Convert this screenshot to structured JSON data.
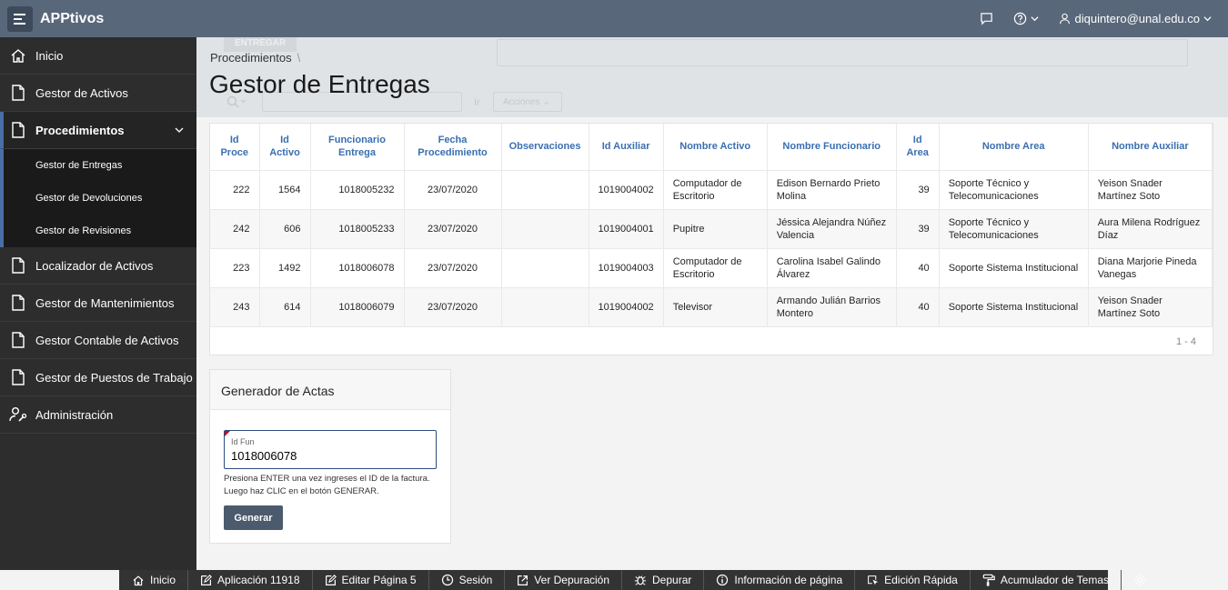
{
  "app": {
    "title": "APPtivos"
  },
  "header": {
    "user": "diquintero@unal.edu.co"
  },
  "sidebar": {
    "items": [
      {
        "label": "Inicio"
      },
      {
        "label": "Gestor de Activos"
      },
      {
        "label": "Procedimientos"
      },
      {
        "label": "Localizador de Activos"
      },
      {
        "label": "Gestor de Mantenimientos"
      },
      {
        "label": "Gestor Contable de Activos"
      },
      {
        "label": "Gestor de Puestos de Trabajo"
      },
      {
        "label": "Administración"
      }
    ],
    "sub": [
      {
        "label": "Gestor de Entregas"
      },
      {
        "label": "Gestor de Devoluciones"
      },
      {
        "label": "Gestor de Revisiones"
      }
    ]
  },
  "page": {
    "breadcrumb": "Procedimientos",
    "title": "Gestor de Entregas",
    "ghost_button": "ENTREGAR",
    "ghost_go": "Ir",
    "ghost_actions": "Acciones"
  },
  "table": {
    "headers": [
      "Id\nProce",
      "Id\nActivo",
      "Funcionario\nEntrega",
      "Fecha\nProcedimiento",
      "Observaciones",
      "Id Auxiliar",
      "Nombre Activo",
      "Nombre Funcionario",
      "Id\nArea",
      "Nombre Area",
      "Nombre Auxiliar"
    ],
    "rows": [
      [
        "222",
        "1564",
        "1018005232",
        "23/07/2020",
        "",
        "1019004002",
        "Computador de Escritorio",
        "Edison Bernardo Prieto Molina",
        "39",
        "Soporte Técnico y Telecomunicaciones",
        "Yeison Snader Martínez Soto"
      ],
      [
        "242",
        "606",
        "1018005233",
        "23/07/2020",
        "",
        "1019004001",
        "Pupitre",
        "Jéssica Alejandra Núñez Valencia",
        "39",
        "Soporte Técnico y Telecomunicaciones",
        "Aura Milena Rodríguez Díaz"
      ],
      [
        "223",
        "1492",
        "1018006078",
        "23/07/2020",
        "",
        "1019004003",
        "Computador de Escritorio",
        "Carolina Isabel Galindo Álvarez",
        "40",
        "Soporte Sistema Institucional",
        "Diana Marjorie Pineda Vanegas"
      ],
      [
        "243",
        "614",
        "1018006079",
        "23/07/2020",
        "",
        "1019004002",
        "Televisor",
        "Armando Julián Barrios Montero",
        "40",
        "Soporte Sistema Institucional",
        "Yeison Snader Martínez Soto"
      ]
    ],
    "pagination": "1 - 4"
  },
  "generator": {
    "title": "Generador de Actas",
    "field_label": "Id Fun",
    "field_value": "1018006078",
    "help": "Presiona ENTER una vez ingreses el ID de la factura. Luego haz CLIC en el botón GENERAR.",
    "button": "Generar"
  },
  "devbar": {
    "items": [
      {
        "label": "Inicio",
        "icon": "home-icon"
      },
      {
        "label": "Aplicación 11918",
        "icon": "edit-icon"
      },
      {
        "label": "Editar Página 5",
        "icon": "edit-icon"
      },
      {
        "label": "Sesión",
        "icon": "clock-icon"
      },
      {
        "label": "Ver Depuración",
        "icon": "external-link-icon"
      },
      {
        "label": "Depurar",
        "icon": "bug-icon"
      },
      {
        "label": "Información de página",
        "icon": "info-icon"
      },
      {
        "label": "Edición Rápida",
        "icon": "cursor-icon"
      },
      {
        "label": "Acumulador de Temas",
        "icon": "paint-roller-icon"
      }
    ]
  }
}
